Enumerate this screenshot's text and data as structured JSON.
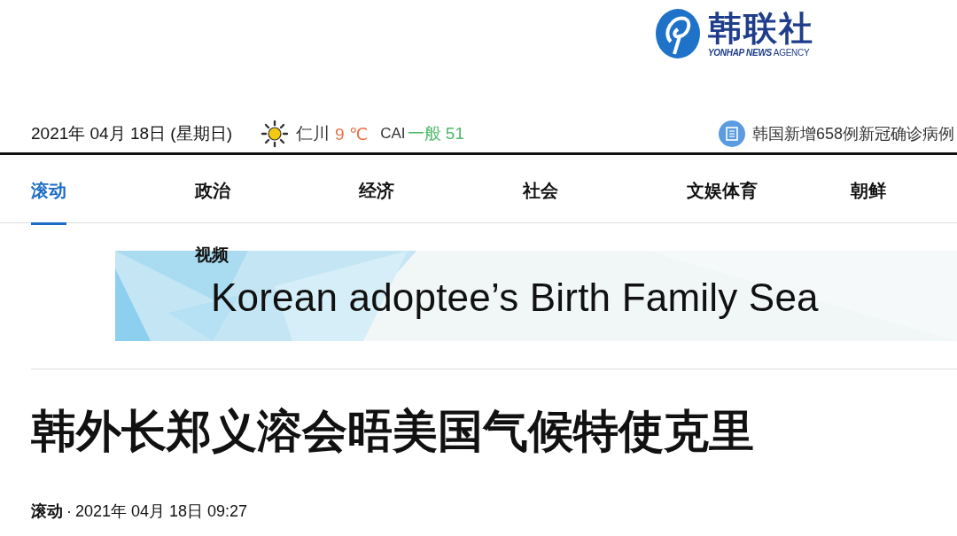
{
  "logo": {
    "name": "韩联社",
    "tagline_bold": "YONHAP NEWS",
    "tagline": "AGENCY"
  },
  "info_bar": {
    "date": "2021年 04月 18日 (星期日)",
    "weather": {
      "city": "仁川",
      "temperature": "9 ℃",
      "index_label": "CAI",
      "index_value": "一般 51"
    },
    "headline": "韩国新增658例新冠确诊病例"
  },
  "nav": [
    {
      "label": "滚动",
      "selected": true
    },
    {
      "label": "政治",
      "selected": false
    },
    {
      "label": "经济",
      "selected": false
    },
    {
      "label": "社会",
      "selected": false
    },
    {
      "label": "文娱体育",
      "selected": false
    },
    {
      "label": "朝鲜",
      "selected": false
    }
  ],
  "banner": {
    "label": "视频",
    "text": "Korean adoptee’s Birth Family Sea"
  },
  "article": {
    "title": "韩外长郑义溶会晤美国气候特使克里",
    "category": "滚动",
    "separator": "·",
    "time": "2021年 04月 18日 09:27"
  }
}
